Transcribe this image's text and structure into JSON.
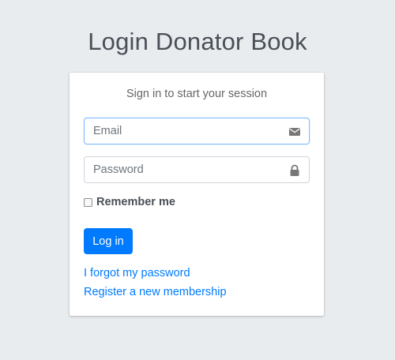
{
  "title": "Login Donator Book",
  "login_box": {
    "message": "Sign in to start your session",
    "email": {
      "placeholder": "Email",
      "value": "",
      "icon": "envelope-icon"
    },
    "password": {
      "placeholder": "Password",
      "value": "",
      "icon": "lock-icon"
    },
    "remember_label": "Remember me",
    "remember_checked": false,
    "submit_label": "Log in",
    "forgot_link": "I forgot my password",
    "register_link": "Register a new membership"
  },
  "colors": {
    "background": "#e9ecef",
    "primary": "#007bff",
    "text": "#495057",
    "icon": "#777777"
  }
}
